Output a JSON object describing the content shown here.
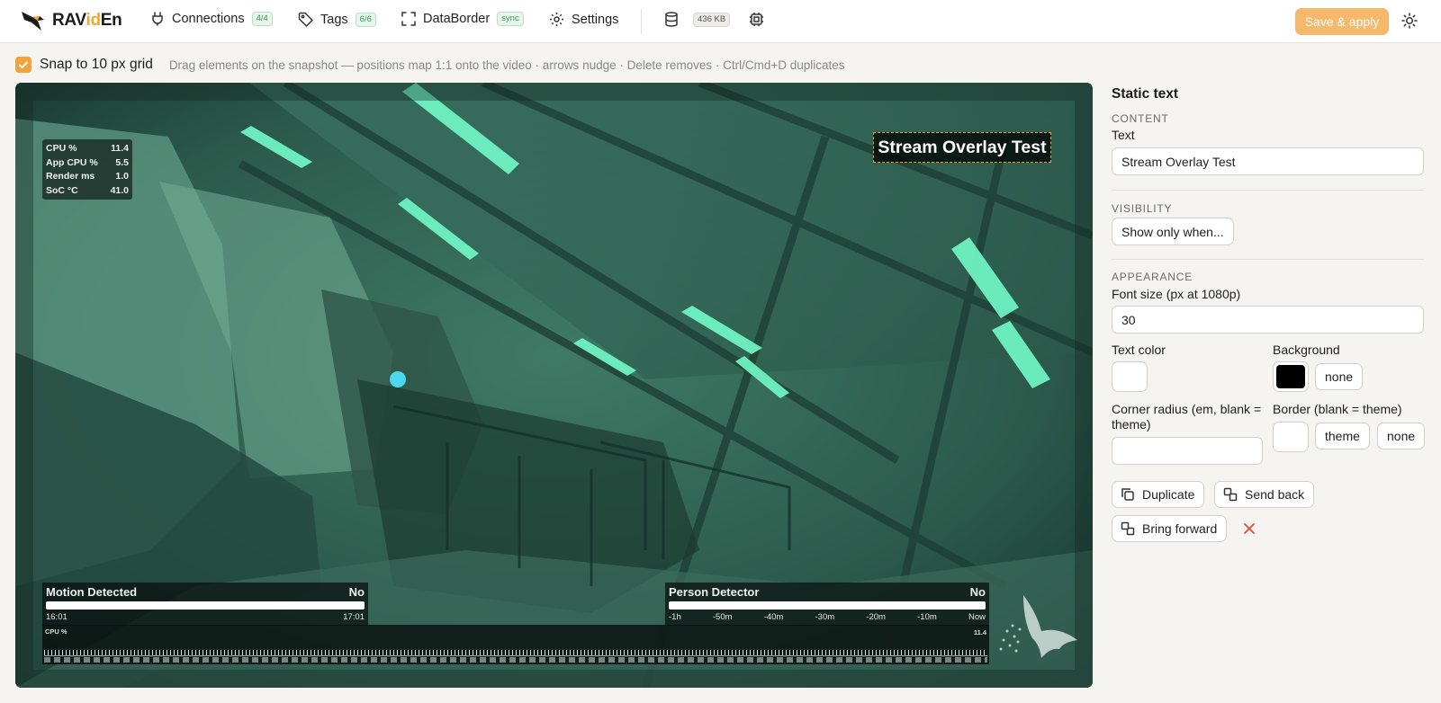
{
  "app": {
    "name_part1": "RAV",
    "name_part2": "id",
    "name_part3": "En"
  },
  "nav": {
    "connections": {
      "label": "Connections",
      "badge": "4/4"
    },
    "tags": {
      "label": "Tags",
      "badge": "6/6"
    },
    "databorder": {
      "label": "DataBorder",
      "badge": "sync"
    },
    "settings": {
      "label": "Settings"
    },
    "storage": {
      "badge": "436 KB"
    },
    "save_label": "Save & apply"
  },
  "snap": {
    "label": "Snap to 10 px grid",
    "checked": true,
    "hint": "Drag elements on the snapshot — positions map 1:1 onto the video · arrows nudge · Delete removes · Ctrl/Cmd+D duplicates"
  },
  "video": {
    "stats": [
      {
        "label": "CPU %",
        "value": "11.4"
      },
      {
        "label": "App CPU %",
        "value": "5.5"
      },
      {
        "label": "Render ms",
        "value": "1.0"
      },
      {
        "label": "SoC °C",
        "value": "41.0"
      }
    ],
    "overlay_text": "Stream Overlay Test",
    "motion": {
      "title": "Motion Detected",
      "value": "No",
      "start": "16:01",
      "end": "17:01"
    },
    "person": {
      "title": "Person Detector",
      "value": "No",
      "axis": [
        "-1h",
        "-50m",
        "-40m",
        "-30m",
        "-20m",
        "-10m",
        "Now"
      ]
    },
    "cpu_strip": {
      "label": "CPU %",
      "value": "11.4"
    }
  },
  "props": {
    "title": "Static text",
    "content_label": "CONTENT",
    "text_label": "Text",
    "text_value": "Stream Overlay Test",
    "visibility_label": "VISIBILITY",
    "visibility_button": "Show only when...",
    "appearance_label": "APPEARANCE",
    "font_size_label": "Font size (px at 1080p)",
    "font_size_value": "30",
    "text_color_label": "Text color",
    "background_label": "Background",
    "background_color": "#000000",
    "background_none": "none",
    "corner_label": "Corner radius (em, blank = theme)",
    "corner_value": "",
    "border_label": "Border (blank = theme)",
    "border_theme": "theme",
    "border_none": "none",
    "duplicate_label": "Duplicate",
    "send_back_label": "Send back",
    "bring_forward_label": "Bring forward"
  },
  "colors": {
    "accent": "#f0a33a",
    "save_button": "#f6b86a",
    "delete": "#e0493e",
    "badge_green": "#3a9a5b"
  }
}
